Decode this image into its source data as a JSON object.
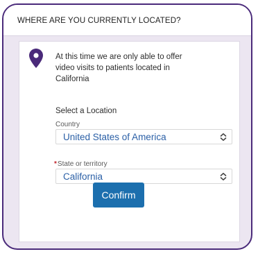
{
  "header": {
    "title": "WHERE ARE YOU CURRENTLY LOCATED?"
  },
  "message": {
    "lines": [
      "At this time we are only able to offer",
      "video visits to patients located in",
      "California"
    ]
  },
  "location": {
    "heading": "Select a Location",
    "country": {
      "label": "Country",
      "value": "United States of America"
    },
    "state": {
      "required_marker": "*",
      "label": "State or territory",
      "value": "California"
    }
  },
  "actions": {
    "confirm_label": "Confirm"
  },
  "colors": {
    "accent": "#4a2a7a",
    "link_blue": "#2a5fa6",
    "button_blue": "#1c6fae",
    "required_red": "#c0262d"
  },
  "icons": {
    "pin": "map-pin-icon",
    "select_arrow": "up-down-chevron-icon"
  }
}
